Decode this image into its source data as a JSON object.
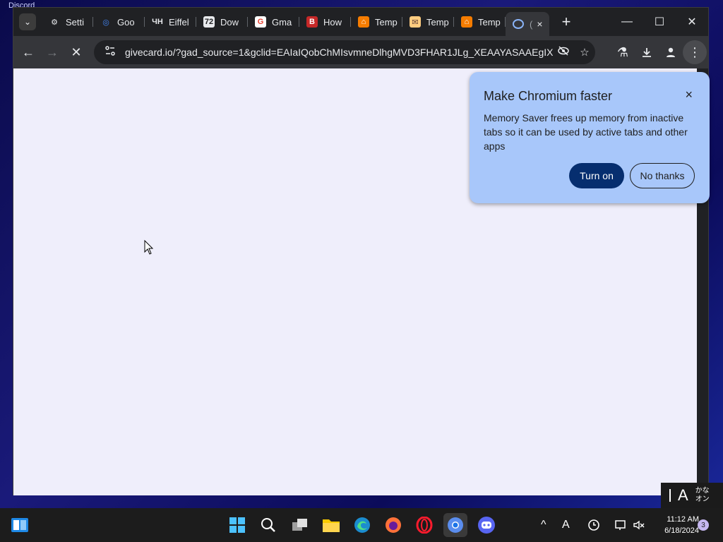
{
  "desktop": {
    "label": "Discord"
  },
  "tabs": [
    {
      "label": "Setti",
      "icon": "gear-icon",
      "fav_color": "#e8eaed",
      "fav_bg": "transparent",
      "glyph": "⚙"
    },
    {
      "label": "Goo",
      "icon": "google-lens-icon",
      "fav_color": "#4285f4",
      "fav_bg": "transparent",
      "glyph": "◎"
    },
    {
      "label": "Eiffel",
      "icon": "eiffel-icon",
      "fav_color": "#e8eaed",
      "fav_bg": "transparent",
      "glyph": "ЧΗ"
    },
    {
      "label": "Dow",
      "icon": "download-site-icon",
      "fav_color": "#202124",
      "fav_bg": "#e8eaed",
      "glyph": "72"
    },
    {
      "label": "Gma",
      "icon": "google-icon",
      "fav_color": "#ea4335",
      "fav_bg": "#ffffff",
      "glyph": "G"
    },
    {
      "label": "How",
      "icon": "b-icon",
      "fav_color": "#ffffff",
      "fav_bg": "#c62828",
      "glyph": "B"
    },
    {
      "label": "Temp",
      "icon": "temp-icon",
      "fav_color": "#ffffff",
      "fav_bg": "#f57c00",
      "glyph": "⌂"
    },
    {
      "label": "Temp",
      "icon": "temp-mail-icon",
      "fav_color": "#5d4037",
      "fav_bg": "#ffcc80",
      "glyph": "✉"
    },
    {
      "label": "Temp",
      "icon": "temp-icon",
      "fav_color": "#ffffff",
      "fav_bg": "#f57c00",
      "glyph": "⌂"
    }
  ],
  "active_tab": {
    "label": "(",
    "icon": "loading-icon",
    "close": "×"
  },
  "new_tab": "+",
  "window_controls": {
    "minimize": "—",
    "maximize": "☐",
    "close": "✕"
  },
  "toolbar": {
    "back": "←",
    "forward": "→",
    "stop": "✕",
    "url": "givecard.io/?gad_source=1&gclid=EAIaIQobChMIsvmneDlhgMVD3FHAR1JLg_XEAAYASAAEgIX..."
  },
  "popup": {
    "title": "Make Chromium faster",
    "close": "×",
    "body": "Memory Saver frees up memory from inactive tabs so it can be used by active tabs and other apps",
    "primary_button": "Turn on",
    "secondary_button": "No thanks"
  },
  "ime": {
    "mode": "A",
    "kana_top": "かな",
    "kana_bottom": "オン"
  },
  "clock": {
    "time": "11:12 AM",
    "date": "6/18/2024"
  },
  "notifications": {
    "count": "3"
  }
}
